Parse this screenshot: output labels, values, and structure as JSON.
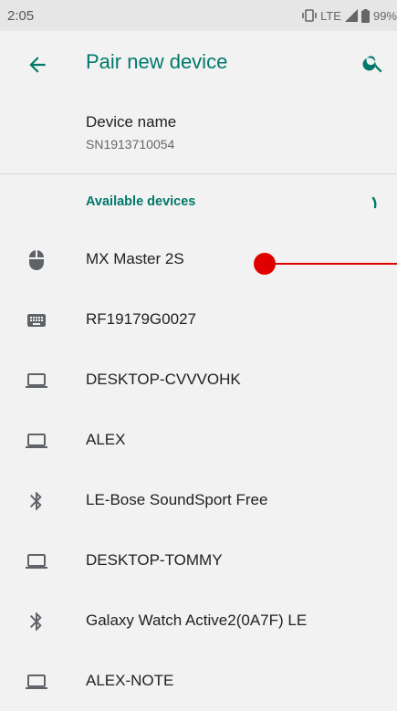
{
  "status_bar": {
    "time": "2:05",
    "network": "LTE",
    "battery": "99%"
  },
  "app_bar": {
    "title": "Pair new device"
  },
  "device_name": {
    "title": "Device name",
    "value": "SN1913710054"
  },
  "available": {
    "header": "Available devices"
  },
  "devices": [
    {
      "label": "MX Master 2S",
      "icon": "mouse-icon"
    },
    {
      "label": "RF19179G0027",
      "icon": "keyboard-icon"
    },
    {
      "label": "DESKTOP-CVVVOHK",
      "icon": "laptop-icon"
    },
    {
      "label": "ALEX",
      "icon": "laptop-icon"
    },
    {
      "label": "LE-Bose SoundSport Free",
      "icon": "bluetooth-icon"
    },
    {
      "label": "DESKTOP-TOMMY",
      "icon": "laptop-icon"
    },
    {
      "label": "Galaxy Watch Active2(0A7F) LE",
      "icon": "bluetooth-icon"
    },
    {
      "label": "ALEX-NOTE",
      "icon": "laptop-icon"
    }
  ],
  "colors": {
    "accent": "#00796b",
    "background": "#f2f2f2",
    "pointer": "#e00000"
  }
}
